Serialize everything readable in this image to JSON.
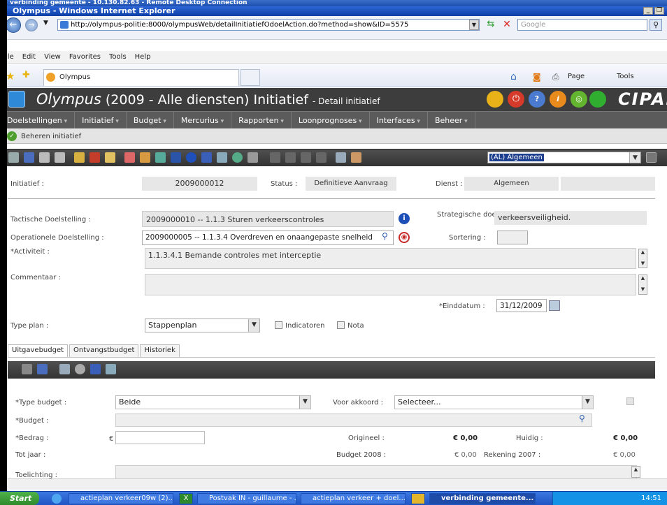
{
  "rdp_title": "verbinding gemeente - 10.130.82.63 - Remote Desktop Connection",
  "ie_title": "Olympus - Windows Internet Explorer",
  "address": {
    "url": "http://olympus-politie:8000/olympusWeb/detailInitiatiefOdoelAction.do?method=show&ID=5575",
    "search_placeholder": "Google"
  },
  "menu": [
    "File",
    "Edit",
    "View",
    "Favorites",
    "Tools",
    "Help"
  ],
  "tab_label": "Olympus",
  "cmdbar": {
    "page": "Page",
    "tools": "Tools"
  },
  "app": {
    "name": "Olympus",
    "context": "(2009 - Alle diensten) Initiatief",
    "subtitle": "- Detail initiatief",
    "logo": "CIPAL"
  },
  "nav": [
    "Doelstellingen",
    "Initiatief",
    "Budget",
    "Mercurius",
    "Rapporten",
    "Loonprognoses",
    "Interfaces",
    "Beheer"
  ],
  "subbar_label": "Beheren initiatief",
  "category_select": "(AL) Algemeen",
  "form": {
    "initiatief_label": "Initiatief :",
    "initiatief_value": "2009000012",
    "status_label": "Status :",
    "status_value": "Definitieve Aanvraag",
    "dienst_label": "Dienst :",
    "dienst_value": "Algemeen",
    "tactische_label": "Tactische Doelstelling :",
    "tactische_value": "2009000010 -- 1.1.3 Sturen verkeerscontroles",
    "strategische_label": "Strategische doelstelling :",
    "strategische_value": "verkeersveiligheid.",
    "operationele_label": "Operationele Doelstelling :",
    "operationele_value": "2009000005 -- 1.1.3.4 Overdreven en onaangepaste snelheid",
    "sortering_label": "Sortering :",
    "activiteit_label": "*Activiteit :",
    "activiteit_value": "1.1.3.4.1 Bemande controles met interceptie",
    "commentaar_label": "Commentaar :",
    "einddatum_label": "*Einddatum :",
    "einddatum_value": "31/12/2009",
    "typeplan_label": "Type plan :",
    "typeplan_value": "Stappenplan",
    "indicatoren_label": "Indicatoren",
    "nota_label": "Nota"
  },
  "tabs": [
    "Uitgavebudget",
    "Ontvangstbudget",
    "Historiek"
  ],
  "budget": {
    "type_label": "*Type budget :",
    "type_value": "Beide",
    "akkoord_label": "Voor akkoord :",
    "akkoord_value": "Selecteer...",
    "budget_label": "*Budget :",
    "bedrag_label": "*Bedrag :",
    "currency": "€",
    "origineel_label": "Origineel :",
    "origineel_value": "€ 0,00",
    "huidig_label": "Huidig :",
    "huidig_value": "€ 0,00",
    "totjaar_label": "Tot jaar :",
    "budget2008_label": "Budget 2008 :",
    "budget2008_value": "€ 0,00",
    "rekening2007_label": "Rekening 2007 :",
    "rekening2007_value": "€ 0,00",
    "toelichting_label": "Toelichting :"
  },
  "taskbar": {
    "start": "Start",
    "tasks": [
      "actieplan verkeer09w (2)...",
      "Postvak IN - guillaume - ...",
      "actieplan verkeer + doel...",
      "verbinding gemeente..."
    ],
    "time": "14:51"
  }
}
